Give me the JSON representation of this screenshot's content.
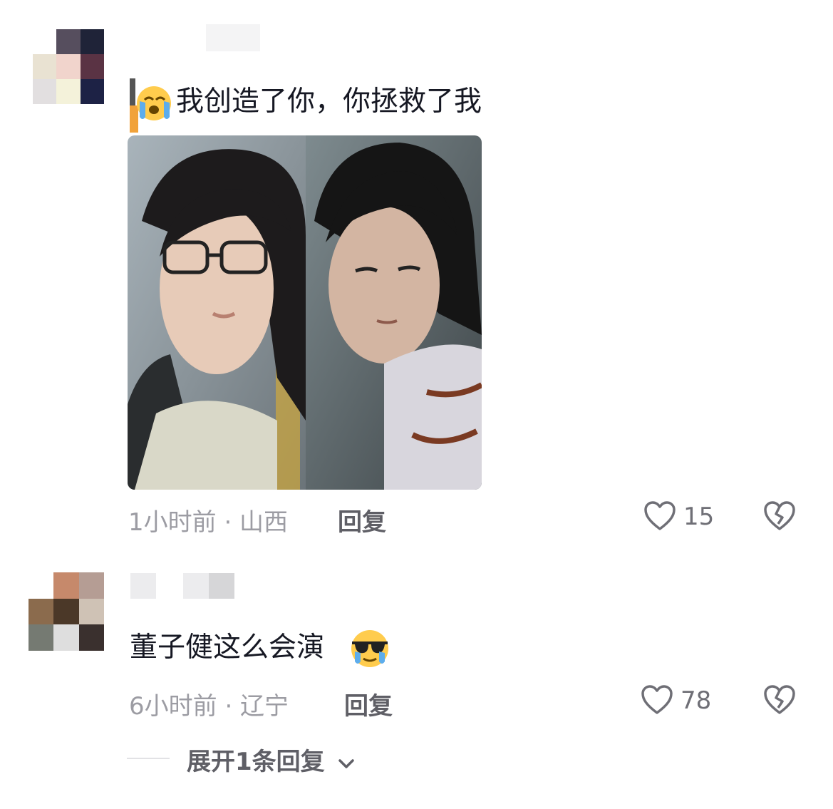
{
  "comments": [
    {
      "avatar_colors": [
        "#ffffff",
        "#564e5e",
        "#1f2338",
        "#e9e2d2",
        "#f1d4cc",
        "#5a3344",
        "#e2dfe0",
        "#f4f2da",
        "#1d2245"
      ],
      "leading_icon": "loudly-crying-face-icon",
      "text": "我创造了你，你拯救了我",
      "meta": "1小时前 · 山西",
      "reply_label": "回复",
      "like_count": "15",
      "has_photo": true
    },
    {
      "avatar_colors": [
        "#ffffff",
        "#c6896b",
        "#b59d94",
        "#8b6b4d",
        "#4b3828",
        "#cfc2b5",
        "#757a72",
        "#dedede",
        "#3a302e"
      ],
      "trailing_icon": "crying-sunglasses-face-icon",
      "text": "董子健这么会演",
      "meta": "6小时前 · 辽宁",
      "reply_label": "回复",
      "like_count": "78"
    }
  ],
  "expand_replies": {
    "label": "展开1条回复"
  },
  "icons": {
    "like": "heart-outline-icon",
    "dislike": "broken-heart-icon",
    "chevron": "chevron-down-icon"
  }
}
